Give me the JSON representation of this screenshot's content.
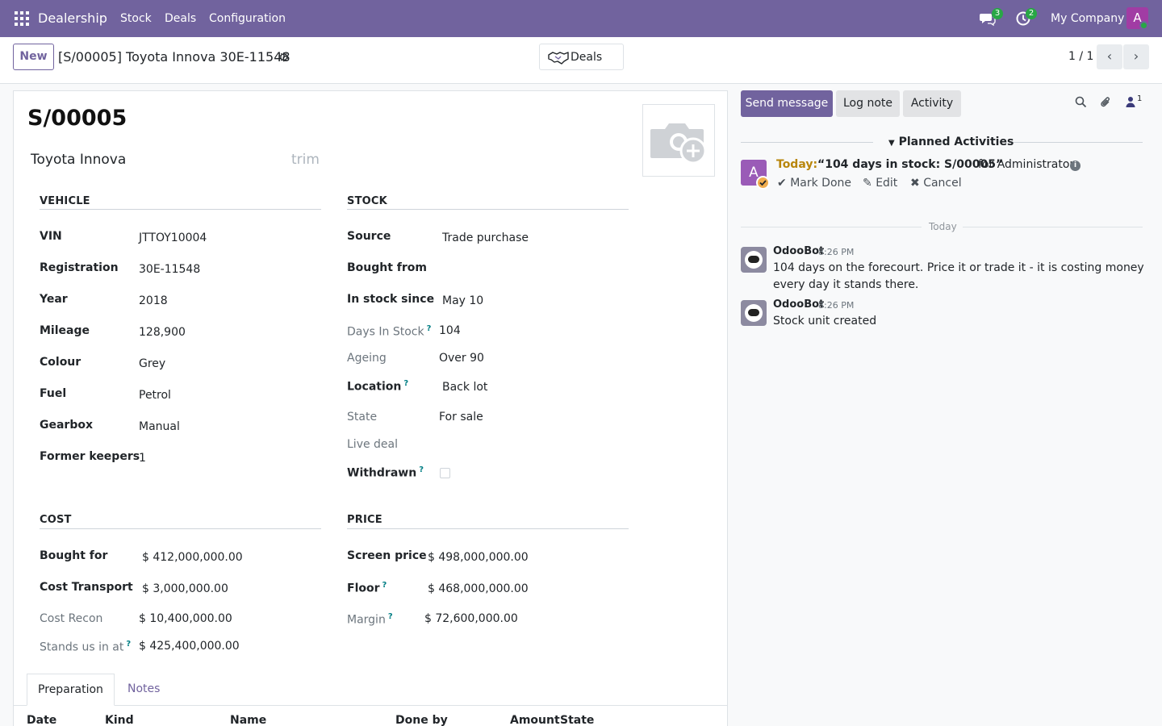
{
  "navbar": {
    "brand": "Dealership",
    "menu": [
      "Stock",
      "Deals",
      "Configuration"
    ],
    "messages_count": "3",
    "activities_count": "2",
    "company": "My Company",
    "avatar_letter": "A"
  },
  "control": {
    "new_label": "New",
    "breadcrumb": "[S/00005] Toyota Innova 30E-11548",
    "deals_button": "Deals",
    "pager": "1 / 1"
  },
  "record": {
    "name": "S/00005",
    "model": "Toyota Innova",
    "trim_placeholder": "trim"
  },
  "vehicle": {
    "title": "VEHICLE",
    "fields": [
      {
        "label": "VIN",
        "value": "JTTOY10004"
      },
      {
        "label": "Registration",
        "value": "30E-11548"
      },
      {
        "label": "Year",
        "value": "2018"
      },
      {
        "label": "Mileage",
        "value": "128,900"
      },
      {
        "label": "Colour",
        "value": "Grey"
      },
      {
        "label": "Fuel",
        "value": "Petrol"
      },
      {
        "label": "Gearbox",
        "value": "Manual"
      },
      {
        "label": "Former keepers",
        "value": "1"
      }
    ]
  },
  "stock": {
    "title": "STOCK",
    "source": {
      "label": "Source",
      "value": "Trade purchase"
    },
    "bought_from": {
      "label": "Bought from",
      "value": ""
    },
    "in_stock_since": {
      "label": "In stock since",
      "value": "May 10"
    },
    "days_in_stock": {
      "label": "Days In Stock",
      "value": "104"
    },
    "ageing": {
      "label": "Ageing",
      "value": "Over 90"
    },
    "location": {
      "label": "Location",
      "value": "Back lot"
    },
    "state": {
      "label": "State",
      "value": "For sale"
    },
    "live_deal": {
      "label": "Live deal",
      "value": ""
    },
    "withdrawn": {
      "label": "Withdrawn",
      "checked": false
    }
  },
  "cost": {
    "title": "COST",
    "bought_for": {
      "label": "Bought for",
      "value": "$ 412,000,000.00"
    },
    "cost_transport": {
      "label": "Cost Transport",
      "value": "$ 3,000,000.00"
    },
    "cost_recon": {
      "label": "Cost Recon",
      "value": "$ 10,400,000.00"
    },
    "stands_us_in_at": {
      "label": "Stands us in at",
      "value": "$ 425,400,000.00"
    }
  },
  "price": {
    "title": "PRICE",
    "screen_price": {
      "label": "Screen price",
      "value": "$ 498,000,000.00"
    },
    "floor": {
      "label": "Floor",
      "value": "$ 468,000,000.00"
    },
    "margin": {
      "label": "Margin",
      "value": "$ 72,600,000.00"
    }
  },
  "tabs": [
    "Preparation",
    "Notes"
  ],
  "prep_table": {
    "columns": [
      "Date",
      "Kind",
      "Name",
      "Done by",
      "Amount",
      "State"
    ]
  },
  "help_mark": "?",
  "chatter": {
    "send_message": "Send message",
    "log_note": "Log note",
    "activity": "Activity",
    "followers_count": "1",
    "planned_title": "Planned Activities",
    "activity_item": {
      "avatar_letter": "A",
      "due": "Today:",
      "summary": "“104 days in stock: S/00005”",
      "assignee": "for Administrator",
      "actions": [
        "Mark Done",
        "Edit",
        "Cancel"
      ]
    },
    "separator": "Today",
    "messages": [
      {
        "author": "OdooBot",
        "time": "8:26 PM",
        "body": "104 days on the forecourt. Price it or trade it - it is costing money every day it stands there."
      },
      {
        "author": "OdooBot",
        "time": "8:26 PM",
        "body": "Stock unit created"
      }
    ]
  },
  "colors": {
    "brand": "#71639e",
    "badge": "#28a745",
    "today": "#b8860b",
    "help": "#017e84"
  }
}
